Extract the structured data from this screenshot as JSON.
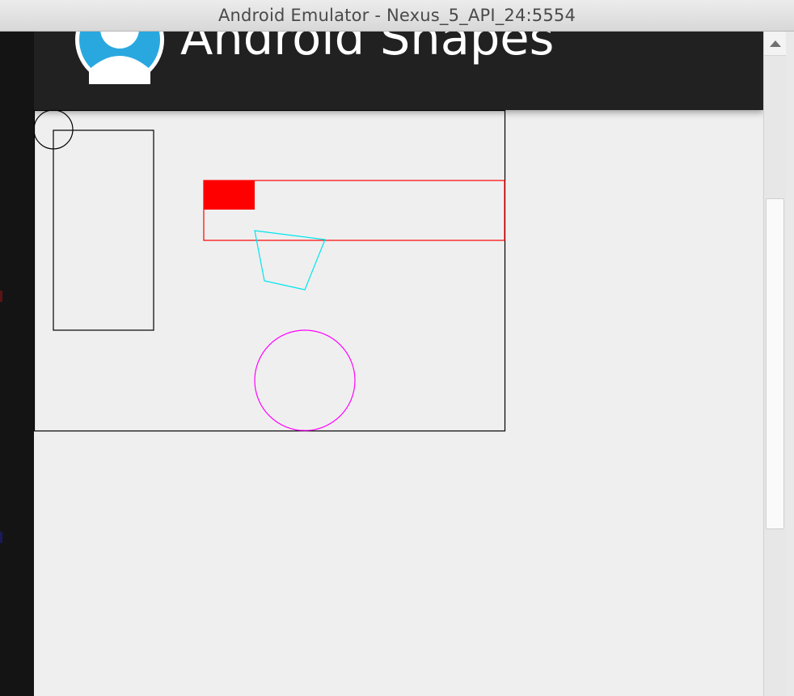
{
  "window": {
    "title": "Android Emulator - Nexus_5_API_24:5554"
  },
  "app": {
    "title": "Android Shapes",
    "logo_icon": "person-avatar-icon",
    "toolbar_color": "#212121",
    "logo_color": "#29a8e0"
  },
  "canvas": {
    "description_colors": {
      "frame": "#000000",
      "circle_small": "#000000",
      "rectangle_tall": "#000000",
      "rectangle_wide": "#ff0000",
      "filled_rectangle": "#ff0000",
      "quadrilateral": "#00e5ee",
      "circle_large": "#ff00ff"
    }
  },
  "scrollbar": {
    "up_icon": "scroll-up-arrow-icon"
  }
}
